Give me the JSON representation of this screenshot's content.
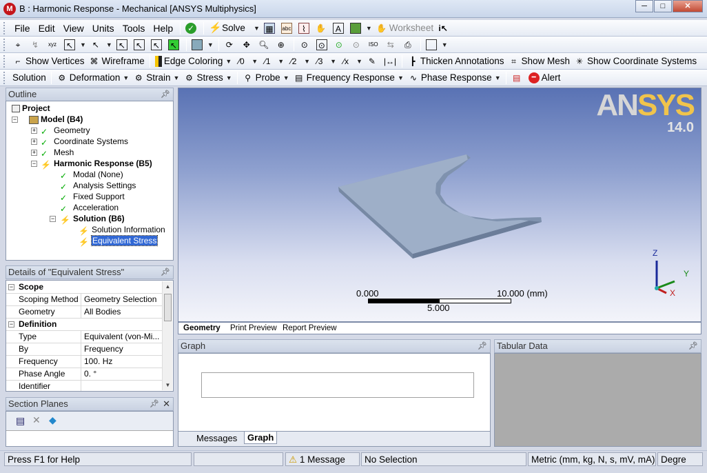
{
  "window": {
    "title": "B : Harmonic Response - Mechanical [ANSYS Multiphysics]",
    "icon_letter": "M",
    "minimize": "─",
    "maximize": "□",
    "close": "✕"
  },
  "menu": [
    "File",
    "Edit",
    "View",
    "Units",
    "Tools",
    "Help"
  ],
  "toolbar1": {
    "solve": "Solve",
    "worksheet": "Worksheet"
  },
  "toolbar3": {
    "show_vertices": "Show Vertices",
    "wireframe": "Wireframe",
    "edge_coloring": "Edge Coloring",
    "thicken": "Thicken Annotations",
    "show_mesh": "Show Mesh",
    "show_cs": "Show Coordinate Systems"
  },
  "toolbar4": {
    "solution": "Solution",
    "deformation": "Deformation",
    "strain": "Strain",
    "stress": "Stress",
    "probe": "Probe",
    "freq": "Frequency Response",
    "phase": "Phase Response",
    "alert": "Alert"
  },
  "outline": {
    "header": "Outline",
    "nodes": [
      "Project",
      "Model (B4)",
      "Geometry",
      "Coordinate Systems",
      "Mesh",
      "Harmonic Response (B5)",
      "Modal (None)",
      "Analysis Settings",
      "Fixed Support",
      "Acceleration",
      "Solution (B6)",
      "Solution Information",
      "Equivalent Stress"
    ]
  },
  "details": {
    "header": "Details of \"Equivalent Stress\"",
    "scope": "Scope",
    "definition": "Definition",
    "rows": [
      [
        "Scoping Method",
        "Geometry Selection"
      ],
      [
        "Geometry",
        "All Bodies"
      ],
      [
        "Type",
        "Equivalent (von-Mi..."
      ],
      [
        "By",
        "Frequency"
      ],
      [
        "Frequency",
        "100. Hz"
      ],
      [
        "Phase Angle",
        "0. °"
      ],
      [
        "Identifier",
        ""
      ]
    ]
  },
  "section_planes": {
    "header": "Section Planes"
  },
  "viewport": {
    "logo_a": "AN",
    "logo_b": "SYS",
    "version": "14.0",
    "scale_start": "0.000",
    "scale_end": "10.000 (mm)",
    "scale_mid": "5.000",
    "axis_x": "X",
    "axis_y": "Y",
    "axis_z": "Z"
  },
  "view_tabs": [
    "Geometry",
    "Print Preview",
    "Report Preview"
  ],
  "graph": {
    "header": "Graph",
    "tabs": [
      "Messages",
      "Graph"
    ]
  },
  "tabular": {
    "header": "Tabular Data"
  },
  "status": {
    "help": "Press F1 for Help",
    "messages": "1 Message",
    "selection": "No Selection",
    "units": "Metric (mm, kg, N, s, mV, mA)",
    "angle": "Degre"
  }
}
